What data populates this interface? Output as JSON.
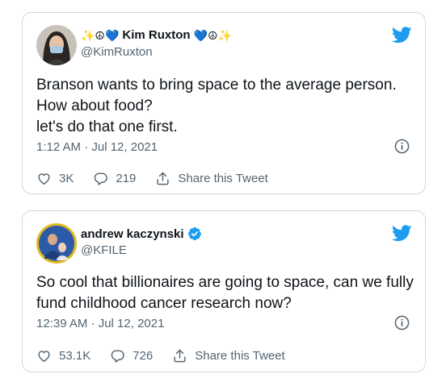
{
  "tweets": [
    {
      "display_name": "Kim Ruxton",
      "name_prefix_emoji": "✨☮💙",
      "name_suffix_emoji": "💙☮✨",
      "handle": "@KimRuxton",
      "text": "Branson wants to bring space to the average person. How about food?\nlet's do that one first.",
      "timestamp": "1:12 AM · Jul 12, 2021",
      "likes": "3K",
      "replies": "219",
      "share_label": "Share this Tweet"
    },
    {
      "display_name": "andrew kaczynski",
      "handle": "@KFILE",
      "text": "So cool that billionaires are going to space, can we fully fund childhood cancer research now?",
      "timestamp": "12:39 AM · Jul 12, 2021",
      "likes": "53.1K",
      "replies": "726",
      "share_label": "Share this Tweet"
    }
  ],
  "colors": {
    "twitter_blue": "#1d9bf0",
    "secondary_text": "#536471",
    "border": "#cfd9de"
  },
  "icons": [
    "twitter-bird-icon",
    "info-icon",
    "heart-icon",
    "reply-icon",
    "share-icon",
    "verified-badge-icon"
  ]
}
